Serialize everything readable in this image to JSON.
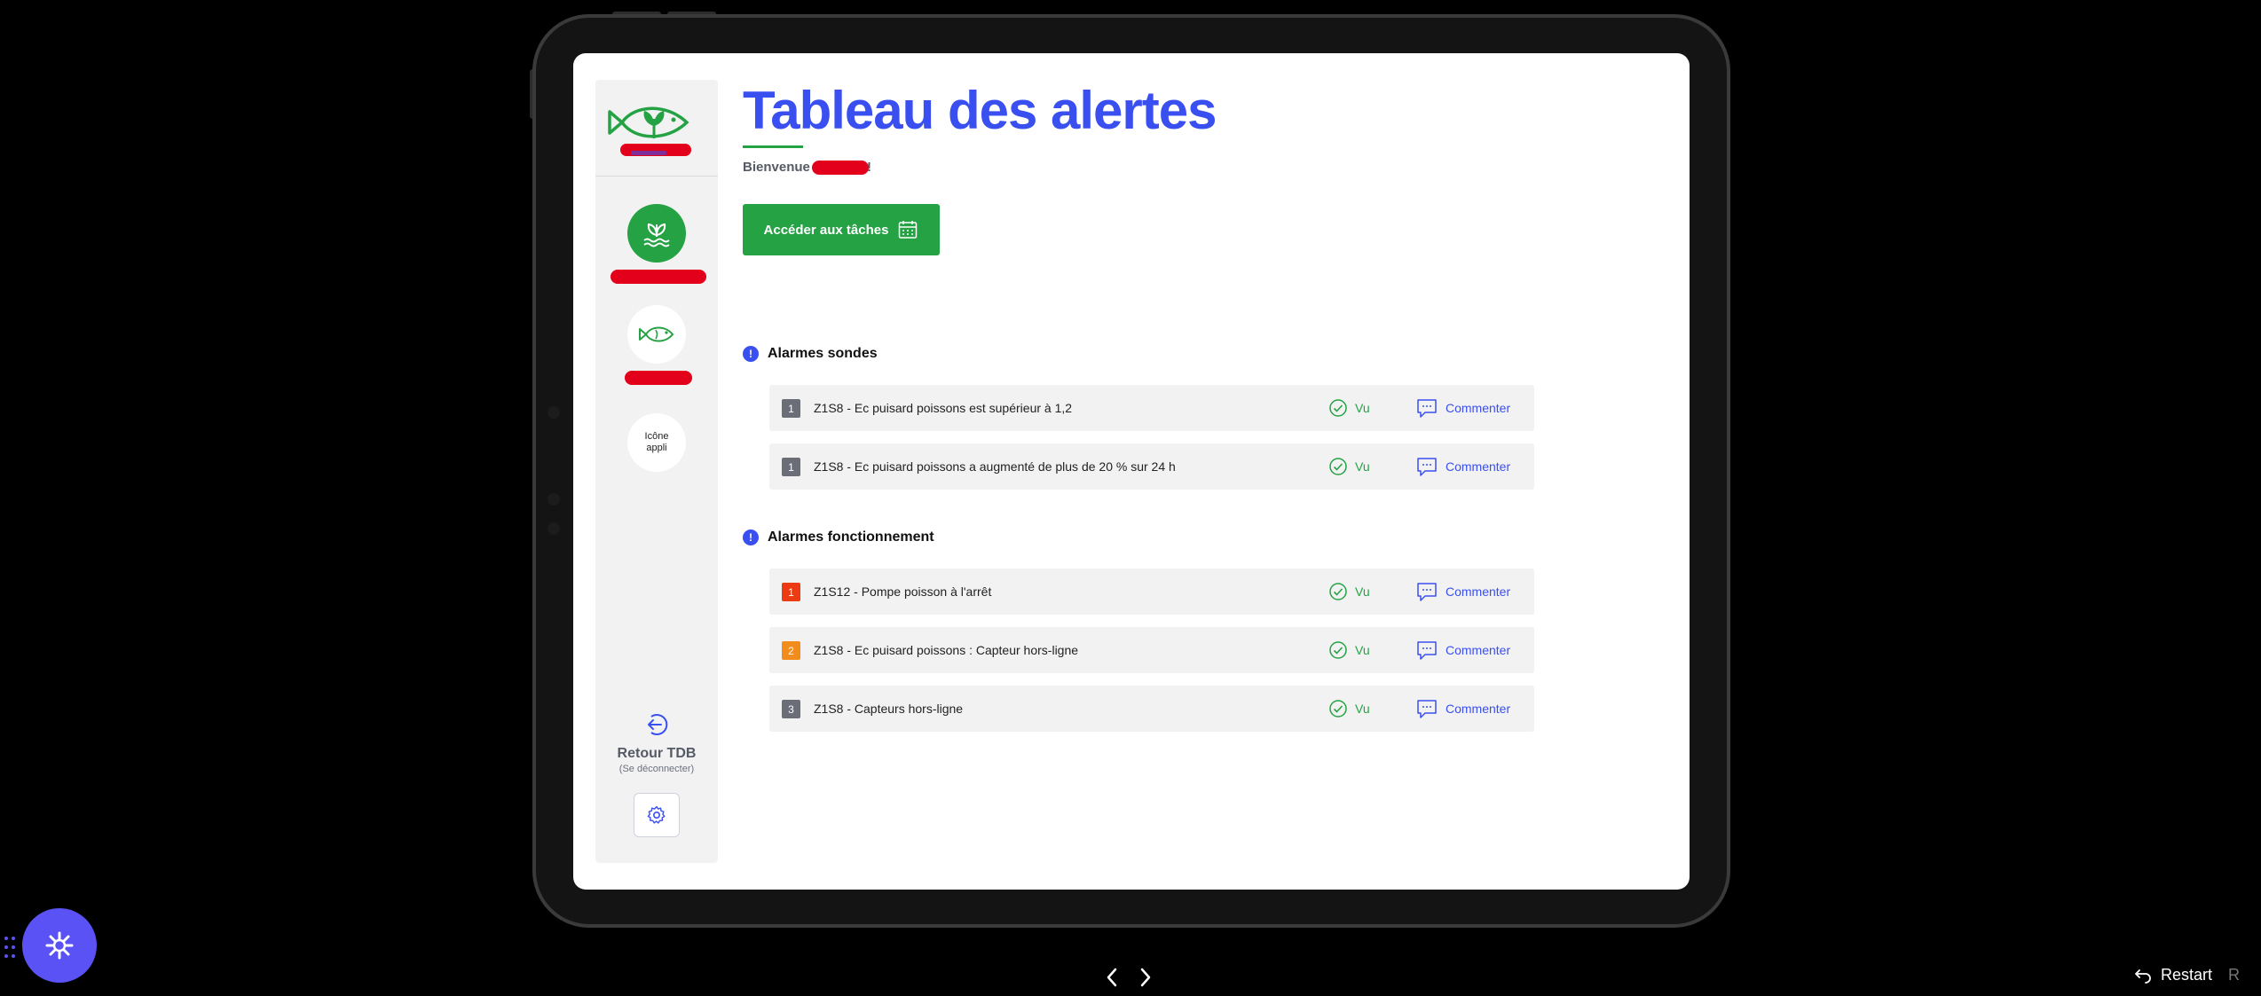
{
  "page": {
    "title": "Tableau des alertes",
    "welcome_prefix": "Bienvenue",
    "welcome_suffix": "!",
    "tasks_button": "Accéder aux tâches"
  },
  "sidebar": {
    "app_icon_label": "Icône appli",
    "logout_title": "Retour TDB",
    "logout_subtitle": "(Se déconnecter)"
  },
  "sections": [
    {
      "title": "Alarmes sondes",
      "alarms": [
        {
          "level": "1",
          "text": "Z1S8 - Ec puisard poissons est supérieur à 1,2",
          "seen": "Vu",
          "comment": "Commenter"
        },
        {
          "level": "1",
          "text": "Z1S8 - Ec puisard poissons a augmenté de plus de 20 % sur 24 h",
          "seen": "Vu",
          "comment": "Commenter"
        }
      ]
    },
    {
      "title": "Alarmes fonctionnement",
      "alarms": [
        {
          "level": "1",
          "text": "Z1S12 - Pompe poisson à l'arrêt",
          "seen": "Vu",
          "comment": "Commenter"
        },
        {
          "level": "2",
          "text": "Z1S8 - Ec puisard poissons : Capteur hors-ligne",
          "seen": "Vu",
          "comment": "Commenter"
        },
        {
          "level": "3",
          "text": "Z1S8 - Capteurs hors-ligne",
          "seen": "Vu",
          "comment": "Commenter"
        }
      ]
    }
  ],
  "player": {
    "restart_label": "Restart",
    "restart_key": "R"
  },
  "colors": {
    "primary_blue": "#3a4ff0",
    "green": "#25a244",
    "badge_grey": "#6b6e76",
    "badge_red": "#ec3a12",
    "badge_orange": "#f28c1c",
    "redaction": "#e3001b",
    "fab_purple": "#5a52f5"
  }
}
